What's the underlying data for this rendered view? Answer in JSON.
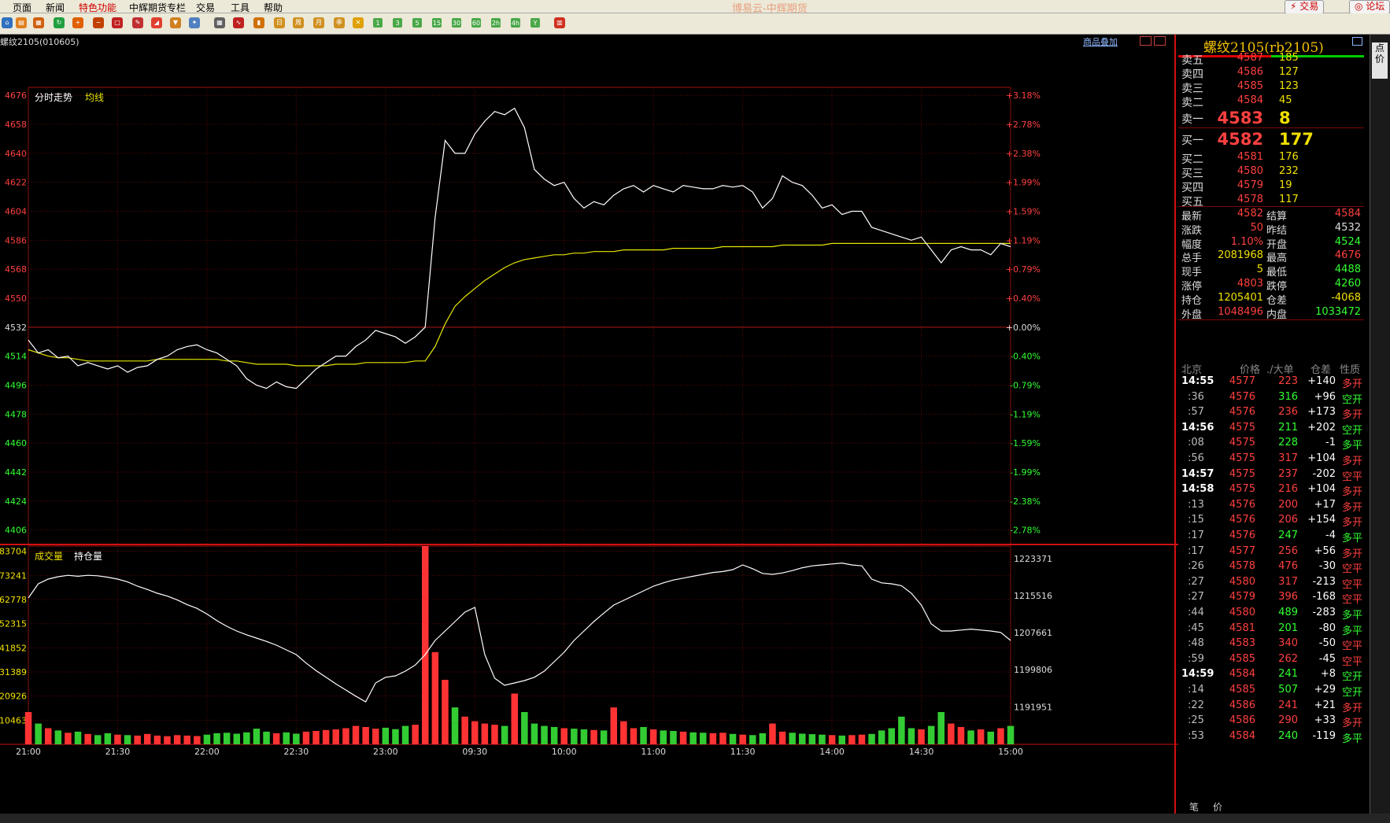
{
  "app_title": "博易云-中辉期货",
  "menu": [
    "页面",
    "新闻",
    "特色功能",
    "中辉期货专栏",
    "交易",
    "工具",
    "帮助"
  ],
  "menu_special": "特色功能",
  "top_buttons": {
    "trade": "交易",
    "forum": "论坛"
  },
  "toolbar": {
    "icons": [
      "home-icon",
      "book-icon",
      "report-icon",
      "refresh-icon",
      "zoom-in-icon",
      "zoom-out-icon",
      "window-icon",
      "pen-icon",
      "chart-icon",
      "filter-icon",
      "plugin-icon",
      "table-icon",
      "timeshare-icon",
      "candle-icon",
      "day-icon",
      "week-icon",
      "month-icon",
      "season-icon",
      "cross-icon"
    ],
    "periods": [
      "1",
      "3",
      "5",
      "15",
      "30",
      "60",
      "2h",
      "4h",
      "Y"
    ],
    "last_icon": "layout-icon"
  },
  "symbol_code": "螺纹2105(010605)",
  "overlay_label": "商品叠加",
  "right_strip_label": "点价",
  "chart_data": [
    {
      "type": "line",
      "title": "分时走势",
      "legend": [
        "分时走势",
        "均线"
      ],
      "colors": {
        "price": "#ffffff",
        "avg": "#e6e600"
      },
      "x_ticks": [
        "21:00",
        "21:30",
        "22:00",
        "22:30",
        "23:00",
        "09:30",
        "10:00",
        "11:00",
        "11:30",
        "14:00",
        "14:30",
        "15:00"
      ],
      "y_ticks_left": [
        4676,
        4658,
        4640,
        4622,
        4604,
        4586,
        4568,
        4550,
        4532,
        4514,
        4496,
        4478,
        4460,
        4442,
        4424,
        4406
      ],
      "y_ticks_right": [
        "+3.18%",
        "+2.78%",
        "+2.38%",
        "+1.99%",
        "+1.59%",
        "+1.19%",
        "+0.79%",
        "+0.40%",
        "+0.00%",
        "-0.40%",
        "-0.79%",
        "-1.19%",
        "-1.59%",
        "-1.99%",
        "-2.38%",
        "-2.78%"
      ],
      "prev_settle": 4532,
      "ylim": [
        4397,
        4681
      ],
      "grid": true,
      "series": [
        {
          "name": "分时走势",
          "values": [
            4524,
            4516,
            4518,
            4513,
            4514,
            4508,
            4510,
            4508,
            4506,
            4508,
            4504,
            4507,
            4508,
            4512,
            4514,
            4518,
            4520,
            4521,
            4518,
            4516,
            4512,
            4508,
            4500,
            4496,
            4494,
            4498,
            4495,
            4494,
            4500,
            4506,
            4510,
            4514,
            4514,
            4520,
            4524,
            4530,
            4528,
            4526,
            4522,
            4526,
            4532,
            4600,
            4648,
            4640,
            4640,
            4652,
            4660,
            4666,
            4664,
            4668,
            4656,
            4630,
            4624,
            4620,
            4622,
            4612,
            4606,
            4610,
            4608,
            4614,
            4618,
            4620,
            4616,
            4620,
            4618,
            4616,
            4620,
            4619,
            4618,
            4618,
            4620,
            4619,
            4620,
            4616,
            4606,
            4612,
            4626,
            4622,
            4620,
            4614,
            4606,
            4608,
            4602,
            4604,
            4604,
            4594,
            4592,
            4590,
            4588,
            4586,
            4588,
            4580,
            4572,
            4580,
            4582,
            4580,
            4580,
            4577,
            4584,
            4582
          ]
        },
        {
          "name": "均线",
          "values": [
            4518,
            4516,
            4514,
            4513,
            4513,
            4512,
            4511,
            4511,
            4511,
            4511,
            4511,
            4511,
            4511,
            4512,
            4512,
            4512,
            4512,
            4512,
            4512,
            4512,
            4511,
            4511,
            4510,
            4509,
            4509,
            4509,
            4509,
            4508,
            4508,
            4508,
            4508,
            4509,
            4509,
            4509,
            4510,
            4510,
            4510,
            4510,
            4510,
            4511,
            4511,
            4520,
            4534,
            4545,
            4551,
            4556,
            4561,
            4565,
            4569,
            4572,
            4574,
            4575,
            4576,
            4577,
            4577,
            4578,
            4578,
            4579,
            4579,
            4579,
            4580,
            4580,
            4580,
            4580,
            4580,
            4581,
            4581,
            4581,
            4581,
            4581,
            4582,
            4582,
            4582,
            4582,
            4582,
            4582,
            4583,
            4583,
            4583,
            4583,
            4583,
            4584,
            4584,
            4584,
            4584,
            4584,
            4584,
            4584,
            4584,
            4584,
            4584,
            4584,
            4584,
            4584,
            4584,
            4584,
            4584,
            4584,
            4584,
            4584
          ]
        }
      ]
    },
    {
      "type": "bar",
      "title": "成交量",
      "legend": [
        "成交量",
        "持仓量"
      ],
      "colors": {
        "up": "#ff3333",
        "down": "#33cc33",
        "oi": "#ffffff"
      },
      "y_ticks_left": [
        83704,
        73241,
        62778,
        52315,
        41852,
        31389,
        20926,
        10463
      ],
      "y_ticks_right": [
        1223371,
        1215516,
        1207661,
        1199806,
        1191951
      ],
      "ylim": [
        0,
        86000
      ],
      "oi_ylim": [
        1184000,
        1226000
      ],
      "series": [
        {
          "name": "成交量",
          "values": [
            14000,
            9000,
            7000,
            6000,
            5000,
            5500,
            4500,
            4000,
            4800,
            4200,
            4000,
            3800,
            4500,
            3800,
            3500,
            4000,
            3800,
            3600,
            4200,
            4800,
            5000,
            4600,
            5200,
            6800,
            5500,
            4800,
            5200,
            4600,
            5500,
            5800,
            6200,
            6500,
            7000,
            8000,
            7500,
            6800,
            7200,
            6600,
            8000,
            8500,
            86000,
            40000,
            28000,
            16000,
            12000,
            10000,
            9000,
            8500,
            8000,
            22000,
            14000,
            9000,
            8000,
            7500,
            7000,
            6800,
            6500,
            6200,
            6000,
            16000,
            10000,
            7000,
            7500,
            6500,
            6000,
            5800,
            5500,
            5200,
            5000,
            4800,
            5000,
            4500,
            4200,
            4000,
            4800,
            9000,
            5500,
            5000,
            4600,
            4400,
            4200,
            4000,
            3800,
            4000,
            4200,
            4500,
            6000,
            7000,
            12000,
            7000,
            6500,
            8000,
            14000,
            9000,
            7500,
            6000,
            6500,
            5500,
            7000,
            8000
          ]
        },
        {
          "name": "持仓量",
          "values": [
            1215000,
            1218000,
            1219000,
            1219500,
            1219800,
            1219600,
            1219800,
            1219700,
            1219400,
            1219000,
            1218400,
            1217500,
            1216800,
            1216000,
            1215400,
            1214600,
            1213600,
            1212800,
            1211600,
            1210200,
            1209000,
            1208000,
            1207200,
            1206500,
            1205800,
            1205000,
            1204000,
            1203000,
            1201200,
            1199600,
            1198200,
            1196800,
            1195500,
            1194200,
            1193000,
            1197000,
            1198200,
            1198500,
            1199500,
            1200800,
            1203000,
            1206000,
            1208000,
            1210000,
            1212000,
            1213000,
            1203000,
            1198000,
            1196500,
            1197000,
            1197500,
            1198200,
            1199500,
            1201500,
            1203500,
            1206000,
            1208000,
            1210000,
            1211800,
            1213500,
            1214500,
            1215500,
            1216500,
            1217500,
            1218200,
            1218800,
            1219200,
            1219600,
            1220000,
            1220400,
            1220600,
            1221000,
            1222000,
            1221200,
            1220200,
            1220000,
            1220300,
            1220800,
            1221400,
            1221800,
            1222000,
            1222200,
            1222400,
            1222000,
            1221800,
            1219000,
            1218200,
            1218000,
            1217600,
            1216000,
            1213500,
            1209500,
            1208000,
            1208000,
            1208200,
            1208400,
            1208200,
            1208000,
            1207700,
            1206000
          ]
        }
      ]
    }
  ],
  "quote": {
    "name": "螺纹2105(rb2105)",
    "asks": [
      {
        "label": "卖五",
        "price": "4587",
        "vol": "185"
      },
      {
        "label": "卖四",
        "price": "4586",
        "vol": "127"
      },
      {
        "label": "卖三",
        "price": "4585",
        "vol": "123"
      },
      {
        "label": "卖二",
        "price": "4584",
        "vol": "45"
      },
      {
        "label": "卖一",
        "price": "4583",
        "vol": "8"
      }
    ],
    "bids": [
      {
        "label": "买一",
        "price": "4582",
        "vol": "177"
      },
      {
        "label": "买二",
        "price": "4581",
        "vol": "176"
      },
      {
        "label": "买三",
        "price": "4580",
        "vol": "232"
      },
      {
        "label": "买四",
        "price": "4579",
        "vol": "19"
      },
      {
        "label": "买五",
        "price": "4578",
        "vol": "117"
      }
    ],
    "stats": [
      {
        "l1": "最新",
        "v1": "4582",
        "c1": "#ff4040",
        "l2": "结算",
        "v2": "4584",
        "c2": "#ff4040"
      },
      {
        "l1": "涨跌",
        "v1": "50",
        "c1": "#ff4040",
        "l2": "昨结",
        "v2": "4532",
        "c2": "#dddddd"
      },
      {
        "l1": "幅度",
        "v1": "1.10%",
        "c1": "#ff4040",
        "l2": "开盘",
        "v2": "4524",
        "c2": "#33ff33"
      },
      {
        "l1": "总手",
        "v1": "2081968",
        "c1": "#f0e000",
        "l2": "最高",
        "v2": "4676",
        "c2": "#ff4040"
      },
      {
        "l1": "现手",
        "v1": "5",
        "c1": "#f0e000",
        "l2": "最低",
        "v2": "4488",
        "c2": "#33ff33"
      },
      {
        "l1": "涨停",
        "v1": "4803",
        "c1": "#ff4040",
        "l2": "跌停",
        "v2": "4260",
        "c2": "#33ff33"
      },
      {
        "l1": "持仓",
        "v1": "1205401",
        "c1": "#f0e000",
        "l2": "仓差",
        "v2": "-4068",
        "c2": "#f0e000"
      },
      {
        "l1": "外盘",
        "v1": "1048496",
        "c1": "#ff4040",
        "l2": "内盘",
        "v2": "1033472",
        "c2": "#33ff33"
      }
    ],
    "tick_header": [
      "北京",
      "价格",
      "./大单",
      "仓差",
      "性质"
    ],
    "ticks": [
      {
        "t": "14:55",
        "bold": true,
        "p": "4577",
        "v": "223",
        "vc": "#ff4040",
        "d": "+140",
        "n": "多开",
        "nc": "#ff4040"
      },
      {
        "t": ":36",
        "p": "4576",
        "v": "316",
        "vc": "#33ff33",
        "d": "+96",
        "n": "空开",
        "nc": "#33ff33"
      },
      {
        "t": ":57",
        "p": "4576",
        "v": "236",
        "vc": "#ff4040",
        "d": "+173",
        "n": "多开",
        "nc": "#ff4040"
      },
      {
        "t": "14:56",
        "bold": true,
        "p": "4575",
        "v": "211",
        "vc": "#33ff33",
        "d": "+202",
        "n": "空开",
        "nc": "#33ff33"
      },
      {
        "t": ":08",
        "p": "4575",
        "v": "228",
        "vc": "#33ff33",
        "d": "-1",
        "n": "多平",
        "nc": "#33ff33"
      },
      {
        "t": ":56",
        "p": "4575",
        "v": "317",
        "vc": "#ff4040",
        "d": "+104",
        "n": "多开",
        "nc": "#ff4040"
      },
      {
        "t": "14:57",
        "bold": true,
        "p": "4575",
        "v": "237",
        "vc": "#ff4040",
        "d": "-202",
        "n": "空平",
        "nc": "#ff4040"
      },
      {
        "t": "14:58",
        "bold": true,
        "p": "4575",
        "v": "216",
        "vc": "#ff4040",
        "d": "+104",
        "n": "多开",
        "nc": "#ff4040"
      },
      {
        "t": ":13",
        "p": "4576",
        "v": "200",
        "vc": "#ff4040",
        "d": "+17",
        "n": "多开",
        "nc": "#ff4040"
      },
      {
        "t": ":15",
        "p": "4576",
        "v": "206",
        "vc": "#ff4040",
        "d": "+154",
        "n": "多开",
        "nc": "#ff4040"
      },
      {
        "t": ":17",
        "p": "4576",
        "v": "247",
        "vc": "#33ff33",
        "d": "-4",
        "n": "多平",
        "nc": "#33ff33"
      },
      {
        "t": ":17",
        "p": "4577",
        "v": "256",
        "vc": "#ff4040",
        "d": "+56",
        "n": "多开",
        "nc": "#ff4040"
      },
      {
        "t": ":26",
        "p": "4578",
        "v": "476",
        "vc": "#ff4040",
        "d": "-30",
        "n": "空平",
        "nc": "#ff4040"
      },
      {
        "t": ":27",
        "p": "4580",
        "v": "317",
        "vc": "#ff4040",
        "d": "-213",
        "n": "空平",
        "nc": "#ff4040"
      },
      {
        "t": ":27",
        "p": "4579",
        "v": "396",
        "vc": "#ff4040",
        "d": "-168",
        "n": "空平",
        "nc": "#ff4040"
      },
      {
        "t": ":44",
        "p": "4580",
        "v": "489",
        "vc": "#33ff33",
        "d": "-283",
        "n": "多平",
        "nc": "#33ff33"
      },
      {
        "t": ":45",
        "p": "4581",
        "v": "201",
        "vc": "#33ff33",
        "d": "-80",
        "n": "多平",
        "nc": "#33ff33"
      },
      {
        "t": ":48",
        "p": "4583",
        "v": "340",
        "vc": "#ff4040",
        "d": "-50",
        "n": "空平",
        "nc": "#ff4040"
      },
      {
        "t": ":59",
        "p": "4585",
        "v": "262",
        "vc": "#ff4040",
        "d": "-45",
        "n": "空平",
        "nc": "#ff4040"
      },
      {
        "t": "14:59",
        "bold": true,
        "p": "4584",
        "v": "241",
        "vc": "#33ff33",
        "d": "+8",
        "n": "空开",
        "nc": "#33ff33"
      },
      {
        "t": ":14",
        "p": "4585",
        "v": "507",
        "vc": "#33ff33",
        "d": "+29",
        "n": "空开",
        "nc": "#33ff33"
      },
      {
        "t": ":22",
        "p": "4586",
        "v": "241",
        "vc": "#ff4040",
        "d": "+21",
        "n": "多开",
        "nc": "#ff4040"
      },
      {
        "t": ":25",
        "p": "4586",
        "v": "290",
        "vc": "#ff4040",
        "d": "+33",
        "n": "多开",
        "nc": "#ff4040"
      },
      {
        "t": ":53",
        "p": "4584",
        "v": "240",
        "vc": "#33ff33",
        "d": "-119",
        "n": "多平",
        "nc": "#33ff33"
      }
    ],
    "bottom_tabs": [
      "笔",
      "价"
    ]
  }
}
